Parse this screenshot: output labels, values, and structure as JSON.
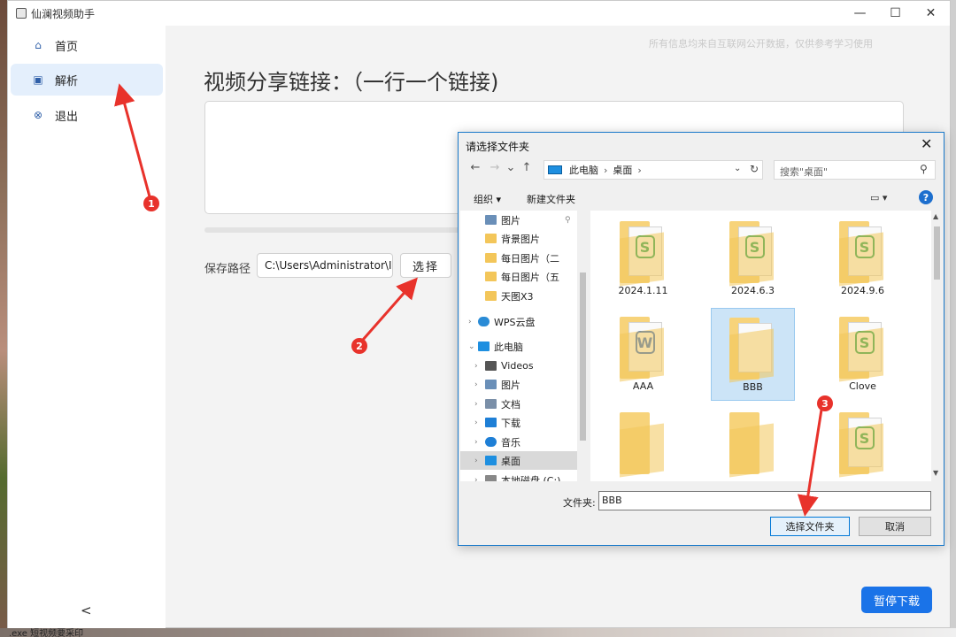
{
  "app": {
    "title": "仙澜视频助手",
    "disclaimer": "所有信息均来自互联网公开数据，仅供参考学习使用"
  },
  "window_controls": {
    "minimize": "—",
    "maximize": "☐",
    "close": "✕"
  },
  "sidebar": {
    "items": [
      {
        "label": "首页",
        "icon": "home-icon",
        "glyph": "⌂",
        "active": false
      },
      {
        "label": "解析",
        "icon": "parse-icon",
        "glyph": "▣",
        "active": true
      },
      {
        "label": "退出",
        "icon": "exit-icon",
        "glyph": "⊗",
        "active": false
      }
    ],
    "collapse": "<"
  },
  "main": {
    "heading": "视频分享链接：（一行一个链接)",
    "links_value": "",
    "progress": 0,
    "save_path_label": "保存路径",
    "save_path_value": "C:\\Users\\Administrator\\I",
    "choose_button": "选择",
    "pause_button": "暂停下载"
  },
  "dialog": {
    "title": "请选择文件夹",
    "close": "✕",
    "nav": {
      "back": "←",
      "forward": "→",
      "history": "⌄",
      "up": "↑"
    },
    "address": {
      "seg1": "此电脑",
      "seg2": "桌面",
      "sep": "›",
      "dropdown": "⌄",
      "refresh": "↻"
    },
    "search_placeholder": "搜索\"桌面\"",
    "search_icon": "⚲",
    "toolbar": {
      "organize": "组织 ▾",
      "new_folder": "新建文件夹",
      "view": "▭ ▾",
      "help": "?"
    },
    "tree": [
      {
        "label": "图片",
        "icon": "pictures-icon",
        "color": "#6a8fb8",
        "level": 2,
        "pinned": true
      },
      {
        "label": "背景图片",
        "icon": "folder-icon",
        "color": "#f3c65a",
        "level": 2
      },
      {
        "label": "每日图片（二",
        "icon": "folder-icon",
        "color": "#f3c65a",
        "level": 2
      },
      {
        "label": "每日图片（五",
        "icon": "folder-icon",
        "color": "#f3c65a",
        "level": 2
      },
      {
        "label": "天图X3",
        "icon": "folder-icon",
        "color": "#f3c65a",
        "level": 2
      },
      {
        "label": "WPS云盘",
        "icon": "cloud-icon",
        "color": "#2a8bd6",
        "level": 1,
        "arrow": "›"
      },
      {
        "label": "此电脑",
        "icon": "computer-icon",
        "color": "#1e8fe0",
        "level": 1,
        "arrow": "⌄"
      },
      {
        "label": "Videos",
        "icon": "videos-icon",
        "color": "#555555",
        "level": 2,
        "arrow": "›"
      },
      {
        "label": "图片",
        "icon": "pictures-icon",
        "color": "#6a8fb8",
        "level": 2,
        "arrow": "›"
      },
      {
        "label": "文档",
        "icon": "documents-icon",
        "color": "#7a8fa8",
        "level": 2,
        "arrow": "›"
      },
      {
        "label": "下载",
        "icon": "downloads-icon",
        "color": "#1e7fd6",
        "level": 2,
        "arrow": "›"
      },
      {
        "label": "音乐",
        "icon": "music-icon",
        "color": "#1e7fd6",
        "level": 2,
        "arrow": "›"
      },
      {
        "label": "桌面",
        "icon": "desktop-icon",
        "color": "#1e8fe0",
        "level": 2,
        "arrow": "›",
        "selected": true
      },
      {
        "label": "本地磁盘 (C:)",
        "icon": "drive-icon",
        "color": "#888888",
        "level": 2,
        "arrow": "›"
      }
    ],
    "files": [
      {
        "label": "2024.1.11",
        "kind": "wps"
      },
      {
        "label": "2024.6.3",
        "kind": "wps"
      },
      {
        "label": "2024.9.6",
        "kind": "wps"
      },
      {
        "label": "AAA",
        "kind": "word"
      },
      {
        "label": "BBB",
        "kind": "plain",
        "selected": true
      },
      {
        "label": "Clove",
        "kind": "wps"
      },
      {
        "label": "",
        "kind": "plain"
      },
      {
        "label": "",
        "kind": "plain"
      },
      {
        "label": "",
        "kind": "wps"
      }
    ],
    "folder_label": "文件夹:",
    "folder_value": "BBB",
    "ok_button": "选择文件夹",
    "cancel_button": "取消"
  },
  "annotations": [
    {
      "number": "1"
    },
    {
      "number": "2"
    },
    {
      "number": "3"
    }
  ],
  "taskbar_fragment": ".exe   短视频要采印",
  "colors": {
    "accent": "#1a73e8",
    "annotation": "#e8322b",
    "active_nav": "#e4effc"
  }
}
